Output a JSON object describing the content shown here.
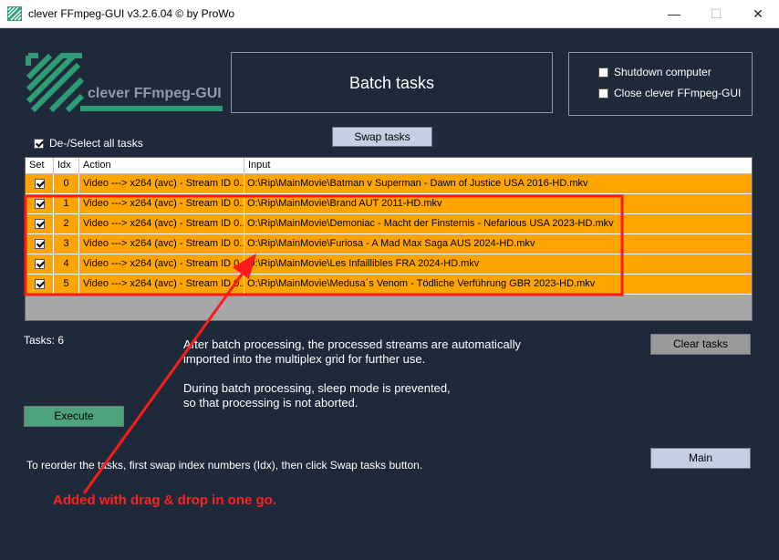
{
  "window": {
    "title": "clever FFmpeg-GUI v3.2.6.04   © by ProWo",
    "minimize_glyph": "—",
    "maximize_glyph": "☐",
    "close_glyph": "✕"
  },
  "logo": {
    "text": "clever FFmpeg-GUI",
    "icon": "ffmpeg-logo-icon"
  },
  "header": {
    "title": "Batch tasks"
  },
  "options": {
    "shutdown_label": "Shutdown computer",
    "shutdown_checked": false,
    "close_label": "Close clever FFmpeg-GUI",
    "close_checked": false
  },
  "select_all": {
    "label": "De-/Select all tasks",
    "checked": true
  },
  "buttons": {
    "swap": "Swap tasks",
    "clear": "Clear tasks",
    "execute": "Execute",
    "main": "Main"
  },
  "grid": {
    "columns": [
      "Set",
      "Idx",
      "Action",
      "Input"
    ],
    "rows": [
      {
        "set": true,
        "idx": "0",
        "action": "Video ---> x264 (avc) - Stream ID 0...",
        "input": "O:\\Rip\\MainMovie\\Batman v Superman - Dawn of Justice USA 2016-HD.mkv"
      },
      {
        "set": true,
        "idx": "1",
        "action": "Video ---> x264 (avc) - Stream ID 0...",
        "input": "O:\\Rip\\MainMovie\\Brand AUT 2011-HD.mkv"
      },
      {
        "set": true,
        "idx": "2",
        "action": "Video ---> x264 (avc) - Stream ID 0...",
        "input": "O:\\Rip\\MainMovie\\Demoniac - Macht der Finsternis - Nefarious USA 2023-HD.mkv"
      },
      {
        "set": true,
        "idx": "3",
        "action": "Video ---> x264 (avc) - Stream ID 0...",
        "input": "O:\\Rip\\MainMovie\\Furiosa - A Mad Max Saga AUS 2024-HD.mkv"
      },
      {
        "set": true,
        "idx": "4",
        "action": "Video ---> x264 (avc) - Stream ID 0...",
        "input": "O:\\Rip\\MainMovie\\Les Infaillibles FRA 2024-HD.mkv"
      },
      {
        "set": true,
        "idx": "5",
        "action": "Video ---> x264 (avc) - Stream ID 0...",
        "input": "O:\\Rip\\MainMovie\\Medusa´s Venom - Tödliche Verführung GBR 2023-HD.mkv"
      }
    ]
  },
  "tasks": {
    "label": "Tasks:",
    "count": "6"
  },
  "info": {
    "line1": "After batch processing, the processed streams are automatically",
    "line2": "imported into the multiplex grid for further use.",
    "line3": "During batch processing, sleep mode is prevented,",
    "line4": "so that processing is not aborted."
  },
  "hint": "To reorder the tasks, first swap index numbers (Idx), then click Swap tasks button.",
  "annotation": "Added with drag & drop in one go.",
  "colors": {
    "background": "#1e2939",
    "row_highlight": "#ffa500",
    "annotation": "#ff2020",
    "logo": "#2e9c74"
  }
}
